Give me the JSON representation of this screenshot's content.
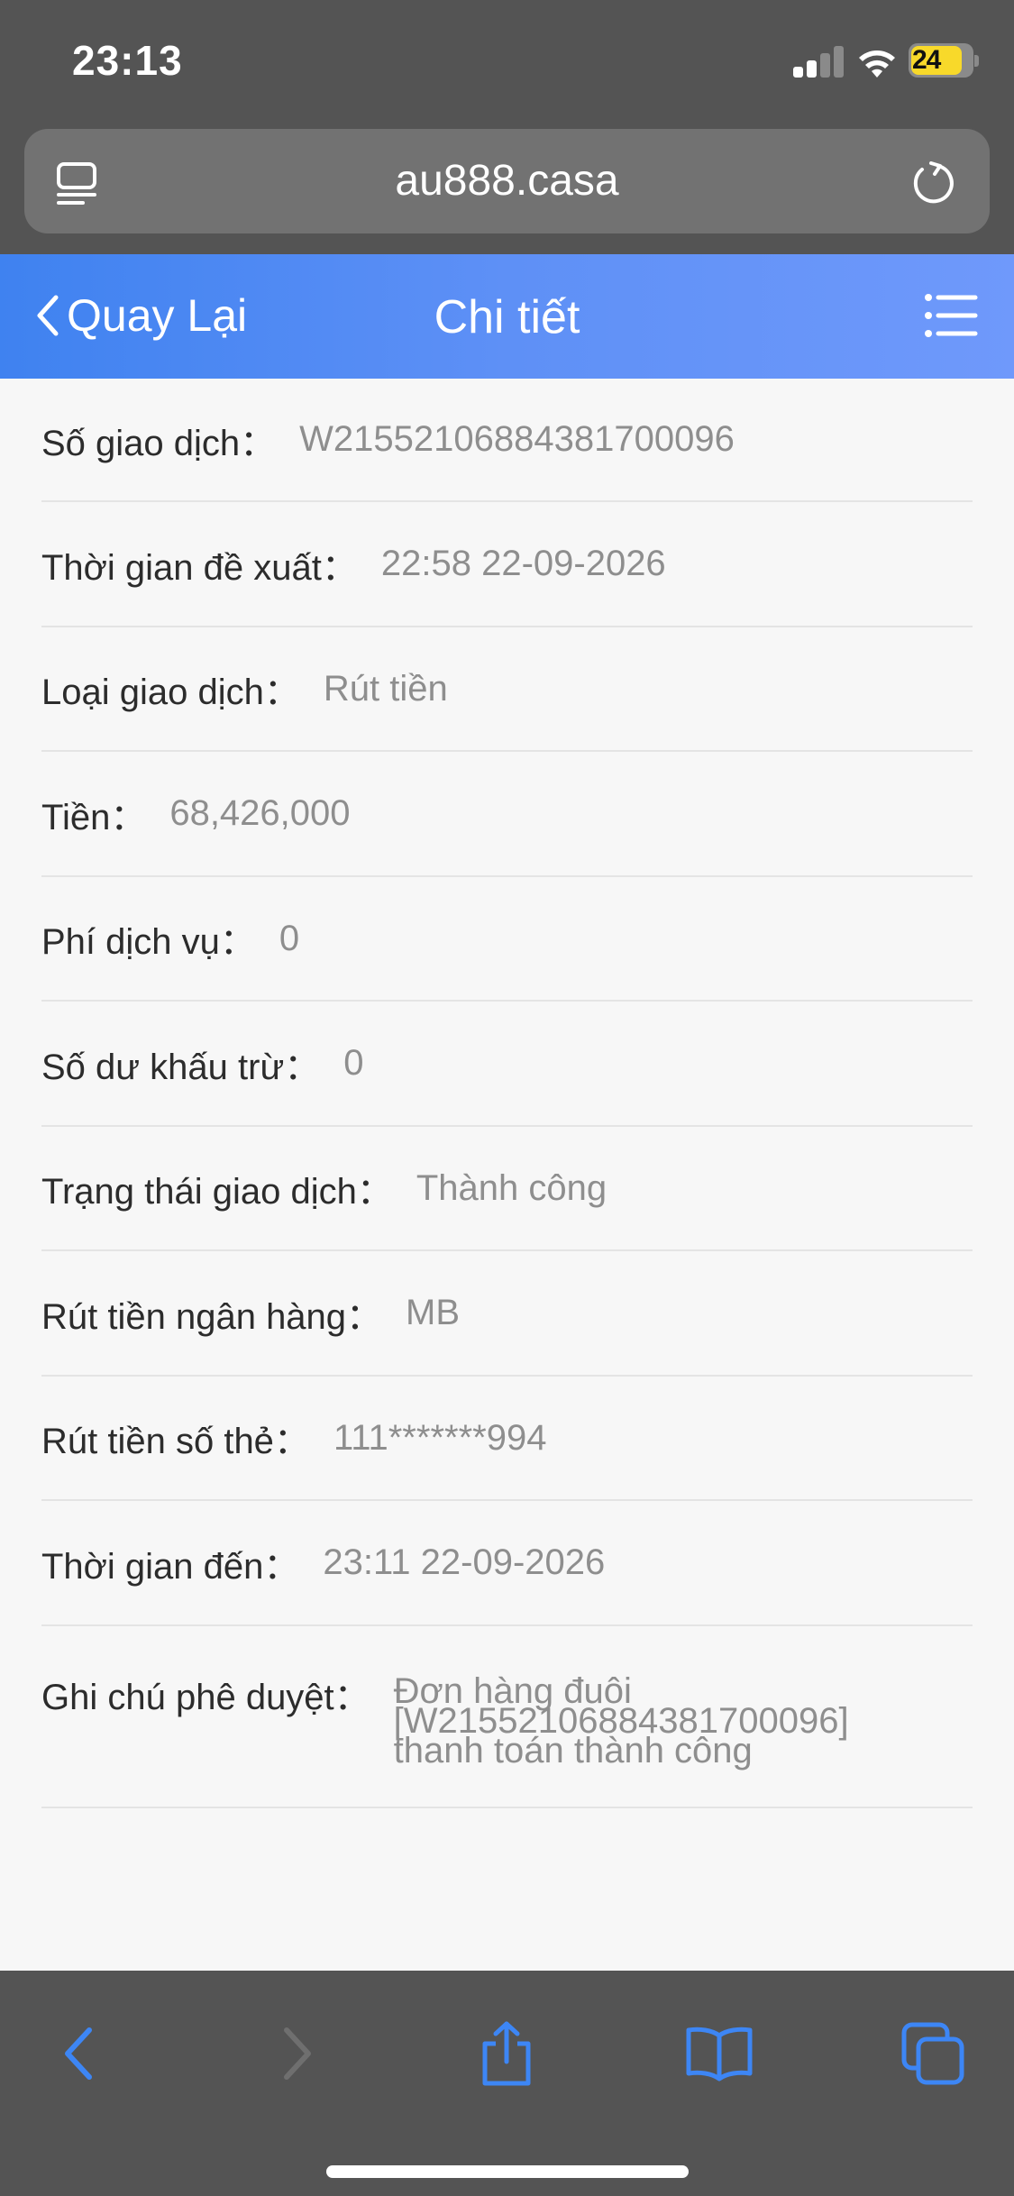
{
  "status_bar": {
    "time": "23:13",
    "battery_level": "24"
  },
  "browser": {
    "url": "au888.casa"
  },
  "header": {
    "back_label": "Quay Lại",
    "title": "Chi tiết"
  },
  "details": [
    {
      "label": "Số giao dịch：",
      "value": "W21552106884381700096"
    },
    {
      "label": "Thời gian đề xuất：",
      "value": "22:58 22-09-2026"
    },
    {
      "label": "Loại giao dịch：",
      "value": "Rút tiền"
    },
    {
      "label": "Tiền：",
      "value": "68,426,000"
    },
    {
      "label": "Phí dịch vụ：",
      "value": "0"
    },
    {
      "label": "Số dư khấu trừ：",
      "value": "0"
    },
    {
      "label": "Trạng thái giao dịch：",
      "value": "Thành công"
    },
    {
      "label": "Rút tiền ngân hàng：",
      "value": "MB"
    },
    {
      "label": "Rút tiền số thẻ：",
      "value": "111*******994"
    },
    {
      "label": "Thời gian đến：",
      "value": "23:11 22-09-2026"
    },
    {
      "label": "Ghi chú phê duyệt：",
      "value_lines": [
        "Đơn hàng đuôi",
        "[W21552106884381700096]",
        "thanh toán thành công"
      ]
    }
  ],
  "colors": {
    "header_gradient_start": "#3f82f0",
    "header_gradient_end": "#6f99fb",
    "browser_chrome": "#545454",
    "toolbar_icon": "#3d86f5",
    "battery": "#f8d92a"
  },
  "icons": {
    "reader": "reader-mode-icon",
    "reload": "reload-icon",
    "back": "chevron-left-icon",
    "menu": "list-menu-icon",
    "toolbar": [
      "back-arrow-icon",
      "forward-arrow-icon",
      "share-icon",
      "bookmarks-icon",
      "tabs-icon"
    ]
  }
}
